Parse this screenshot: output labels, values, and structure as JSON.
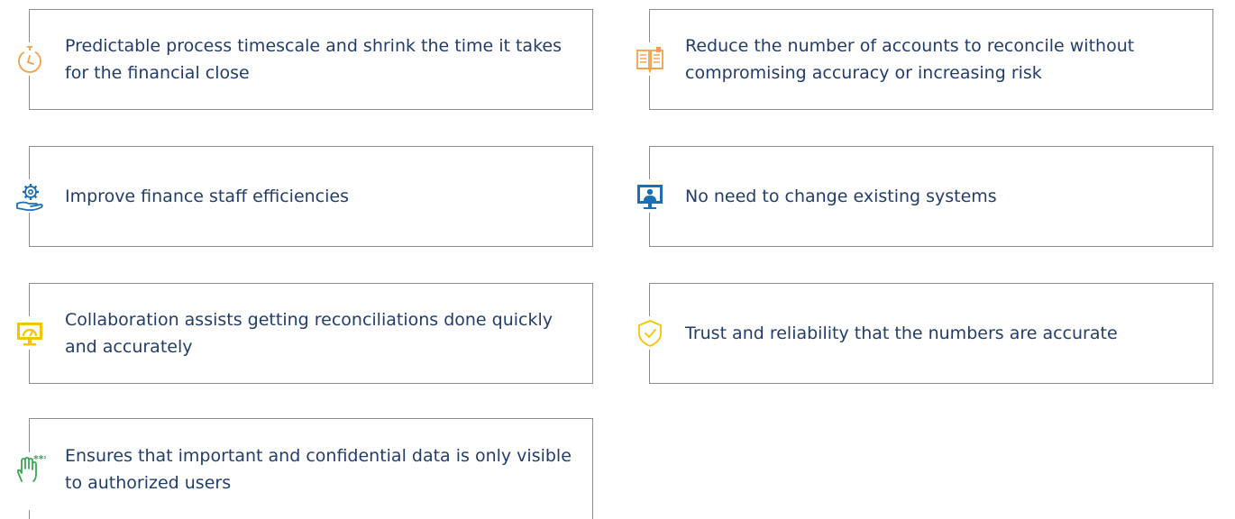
{
  "benefits": [
    {
      "icon": "stopwatch-icon",
      "color": "#f0a04b",
      "text": "Predictable process timescale and shrink the time it takes for the financial close"
    },
    {
      "icon": "open-book-icon",
      "color": "#f0a04b",
      "text": "Reduce the number of accounts to reconcile without compromising accuracy or increasing risk"
    },
    {
      "icon": "gear-in-hand-icon",
      "color": "#1a6fb5",
      "text": "Improve finance staff efficiencies"
    },
    {
      "icon": "monitor-user-icon",
      "color": "#1a6fb5",
      "text": "No need to change existing systems"
    },
    {
      "icon": "dashboard-monitor-icon",
      "color": "#f5c400",
      "text": "Collaboration assists getting reconciliations done quickly and accurately"
    },
    {
      "icon": "shield-check-icon",
      "color": "#f5c400",
      "text": "Trust and reliability that the numbers are accurate"
    },
    {
      "icon": "hand-password-icon",
      "color": "#3aa655",
      "text": "Ensures that important and confidential data is only visible to authorized users"
    }
  ]
}
